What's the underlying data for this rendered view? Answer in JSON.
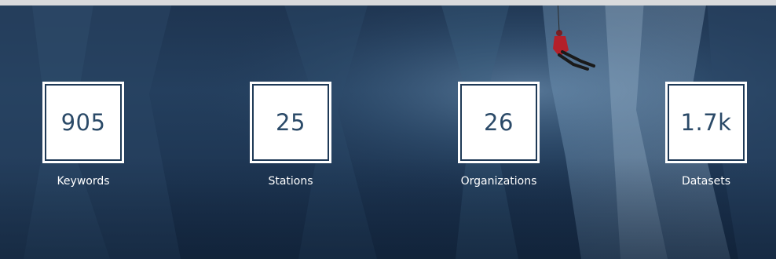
{
  "stats": [
    {
      "value": "905",
      "label": "Keywords"
    },
    {
      "value": "25",
      "label": "Stations"
    },
    {
      "value": "26",
      "label": "Organizations"
    },
    {
      "value": "1.7k",
      "label": "Datasets"
    }
  ],
  "colors": {
    "background": "#1e3450",
    "box_fill": "#ffffff",
    "value_text": "#2b4a68",
    "label_text": "#ffffff",
    "top_bar": "#d9dadc"
  }
}
